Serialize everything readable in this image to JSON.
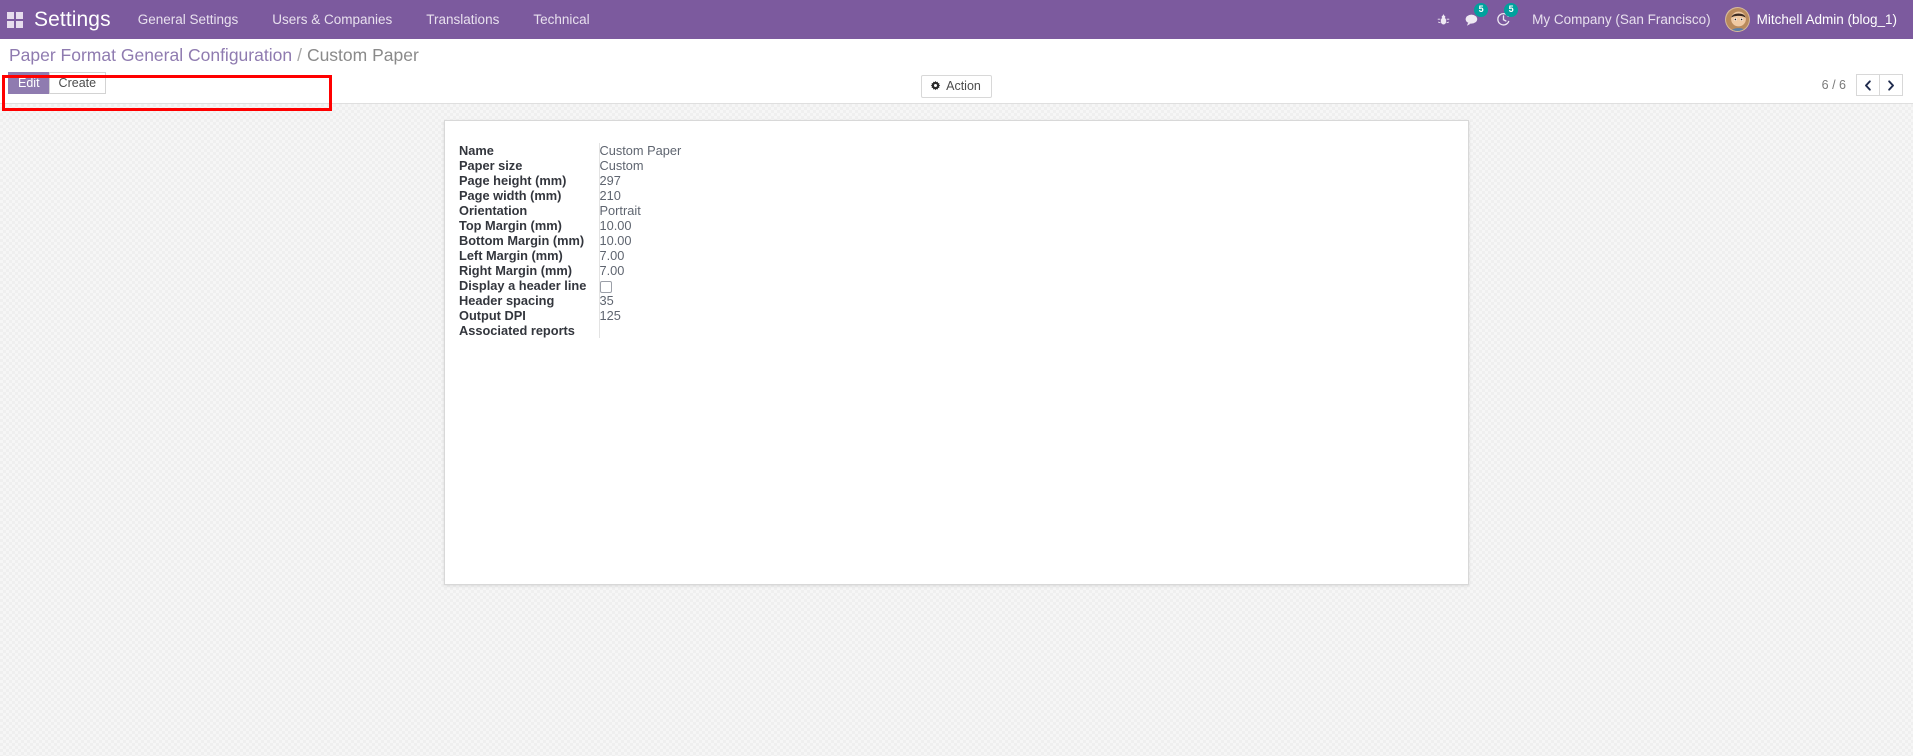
{
  "navbar": {
    "apps_icon": "apps-grid-icon",
    "brand": "Settings",
    "menu_items": [
      {
        "label": "General Settings"
      },
      {
        "label": "Users & Companies"
      },
      {
        "label": "Translations"
      },
      {
        "label": "Technical"
      }
    ],
    "sys_icons": [
      {
        "name": "bug-icon",
        "glyph": "🐞",
        "badge": null
      },
      {
        "name": "messages-icon",
        "glyph": "💬",
        "badge": "5"
      },
      {
        "name": "activity-clock-icon",
        "glyph": "◴",
        "badge": "5"
      }
    ],
    "company": "My Company (San Francisco)",
    "user": "Mitchell Admin (blog_1)",
    "accent_color": "#7c5a9e",
    "badge_color": "#00a09d"
  },
  "control_panel": {
    "breadcrumb": {
      "parent": "Paper Format General Configuration",
      "separator": "/",
      "current": "Custom Paper"
    },
    "buttons": {
      "edit_label": "Edit",
      "create_label": "Create",
      "action_label": "Action",
      "action_icon": "gear-icon"
    },
    "pager": {
      "count": "6 / 6",
      "prev_icon": "chevron-left-icon",
      "next_icon": "chevron-right-icon"
    },
    "annotation": {
      "color": "#ff0000",
      "target": "breadcrumb"
    }
  },
  "form": {
    "fields": [
      {
        "label": "Name",
        "value": "Custom Paper",
        "type": "text"
      },
      {
        "label": "Paper size",
        "value": "Custom",
        "type": "text"
      },
      {
        "label": "Page height (mm)",
        "value": "297",
        "type": "text"
      },
      {
        "label": "Page width (mm)",
        "value": "210",
        "type": "text"
      },
      {
        "label": "Orientation",
        "value": "Portrait",
        "type": "text"
      },
      {
        "label": "Top Margin (mm)",
        "value": "10.00",
        "type": "text"
      },
      {
        "label": "Bottom Margin (mm)",
        "value": "10.00",
        "type": "text"
      },
      {
        "label": "Left Margin (mm)",
        "value": "7.00",
        "type": "text"
      },
      {
        "label": "Right Margin (mm)",
        "value": "7.00",
        "type": "text"
      },
      {
        "label": "Display a header line",
        "value": "",
        "type": "checkbox",
        "checked": false
      },
      {
        "label": "Header spacing",
        "value": "35",
        "type": "text"
      },
      {
        "label": "Output DPI",
        "value": "125",
        "type": "text"
      },
      {
        "label": "Associated reports",
        "value": "",
        "type": "text"
      }
    ]
  }
}
